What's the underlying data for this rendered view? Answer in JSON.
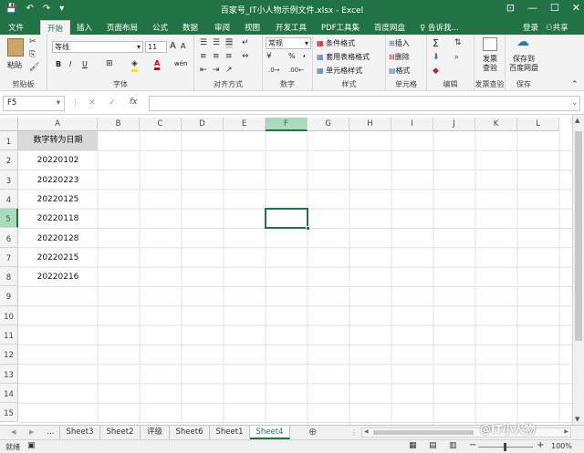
{
  "title_bar": {
    "title": "百家号_IT小人物示例文件.xlsx - Excel",
    "qat": {
      "save": "💾",
      "undo": "↶",
      "redo": "↷",
      "more": "▾"
    },
    "win": {
      "restore": "⊡",
      "minimize": "—",
      "maximize": "☐",
      "close": "✕"
    }
  },
  "menu": {
    "tabs": [
      "文件",
      "开始",
      "插入",
      "页面布局",
      "公式",
      "数据",
      "审阅",
      "视图",
      "开发工具",
      "PDF工具集",
      "百度网盘"
    ],
    "active_tab": "开始",
    "tell_me": "告诉我...",
    "login": "登录",
    "share": "共享"
  },
  "ribbon": {
    "clipboard": {
      "paste": "粘贴",
      "label": "剪贴板"
    },
    "font": {
      "name": "等线",
      "size": "11",
      "label": "字体",
      "bold": "B",
      "italic": "I",
      "underline": "U",
      "grow": "A",
      "shrink": "A",
      "color_letter": "A",
      "wen": "wén"
    },
    "alignment": {
      "label": "对齐方式"
    },
    "number": {
      "format": "常规",
      "percent": "%",
      "comma": ",",
      "label": "数字"
    },
    "styles": {
      "cond": "条件格式",
      "table": "套用表格格式",
      "cell": "单元格样式",
      "label": "样式"
    },
    "cells": {
      "insert": "插入",
      "delete": "删除",
      "format": "格式",
      "label": "单元格"
    },
    "editing": {
      "label": "编辑",
      "sum": "Σ"
    },
    "invoice": {
      "btn1": "发票",
      "btn2": "查验",
      "label": "发票查验"
    },
    "save": {
      "btn1": "保存到",
      "btn2": "百度网盘",
      "label": "保存"
    }
  },
  "formula_bar": {
    "name_box": "F5",
    "cancel": "✕",
    "enter": "✓",
    "fx": "fx",
    "value": ""
  },
  "sheet": {
    "columns": [
      "A",
      "B",
      "C",
      "D",
      "E",
      "F",
      "G",
      "H",
      "I",
      "J",
      "K",
      "L"
    ],
    "selected_column": "F",
    "rows": [
      "1",
      "2",
      "3",
      "4",
      "5",
      "6",
      "7",
      "8",
      "9",
      "10",
      "11",
      "12",
      "13",
      "14",
      "15"
    ],
    "selected_row": "5",
    "a1": "数字转为日期",
    "a_values": [
      "20220102",
      "20220223",
      "20220125",
      "20220118",
      "20220128",
      "20220215",
      "20220216"
    ]
  },
  "tabs_bar": {
    "nav_prev": "◀",
    "nav_next": "▶",
    "ellipsis": "...",
    "sheets": [
      "Sheet3",
      "Sheet2",
      "评级",
      "Sheet6",
      "Sheet1",
      "Sheet4"
    ],
    "active": "Sheet4",
    "add": "⊕"
  },
  "status": {
    "ready": "就绪",
    "zoom": "100%",
    "minus": "−",
    "plus": "+"
  },
  "watermark": "@IT小人物",
  "colors": {
    "accent": "#217346",
    "selection": "#a9dab9"
  }
}
